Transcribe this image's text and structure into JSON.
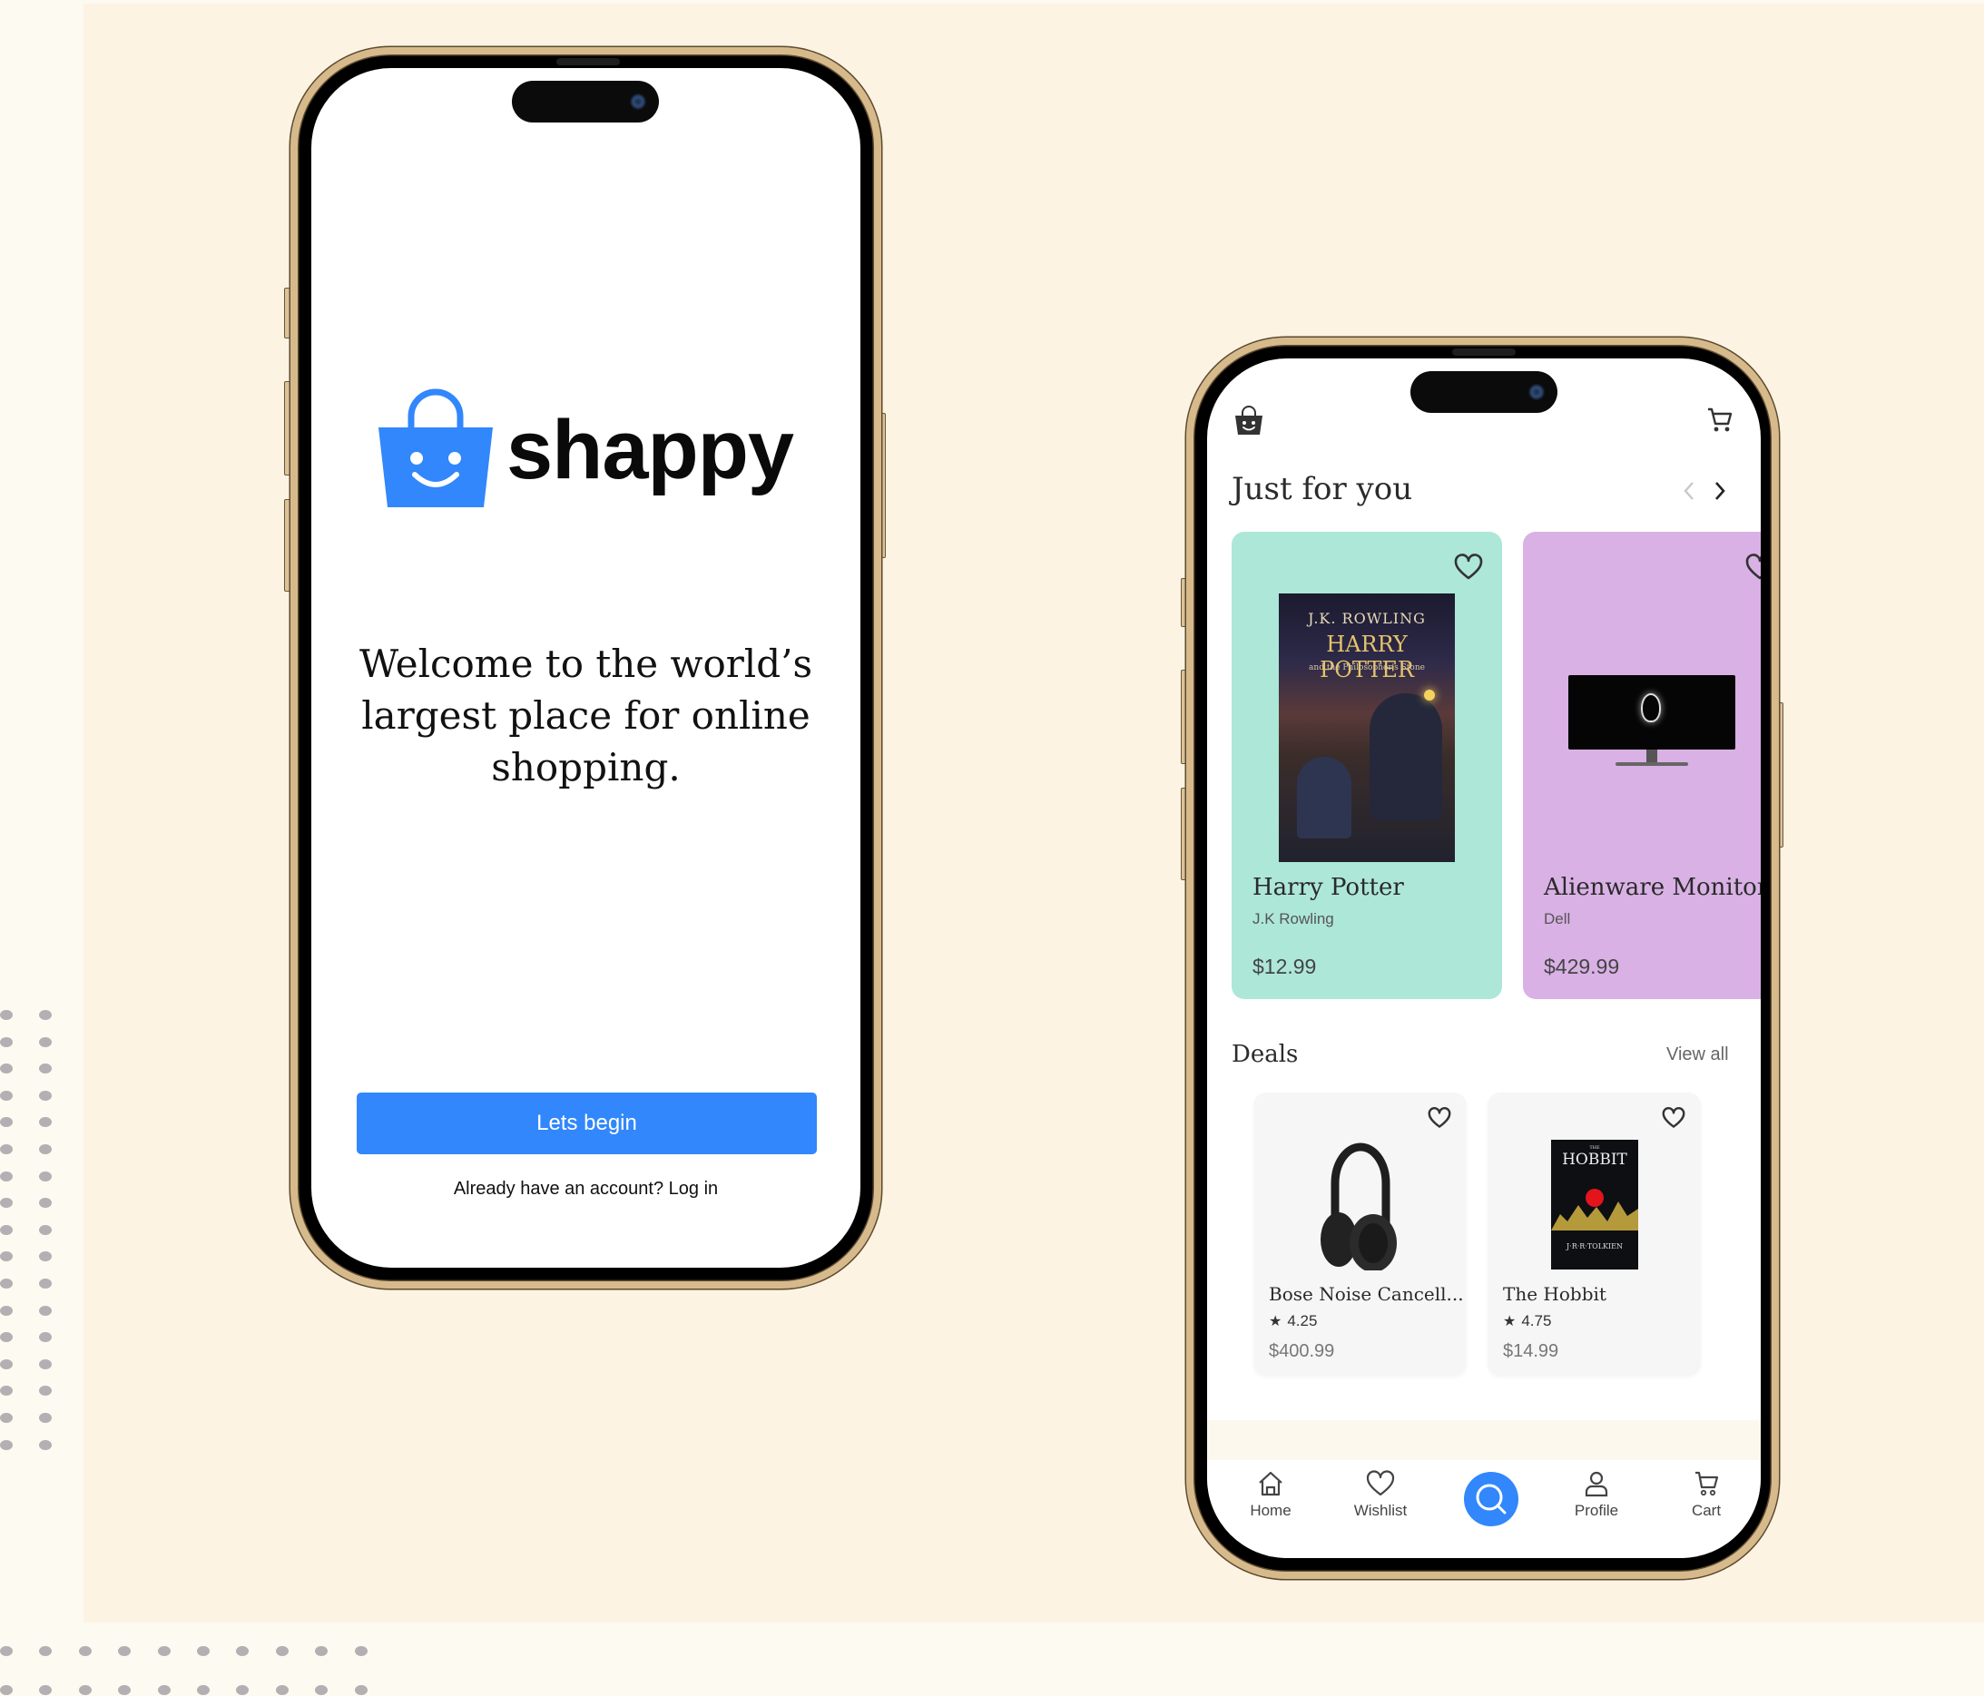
{
  "colors": {
    "brand_blue": "#3187fb",
    "panel_beige": "#fdf3e3",
    "card_mint": "#ade7d8",
    "card_lilac": "#d9b1e5",
    "deal_card": "#f6f6f6"
  },
  "welcome_screen": {
    "brand_name": "shappy",
    "logo_icon": "smiling-shopping-bag-icon",
    "headline_lines": [
      "Welcome to the world’s",
      "largest place for online",
      "shopping."
    ],
    "primary_button": "Lets begin",
    "login_prompt": "Already have an account? Log in"
  },
  "home_screen": {
    "header": {
      "logo_icon": "shopping-bag-icon",
      "cart_icon": "cart-icon"
    },
    "featured": {
      "title": "Just for you",
      "prev_icon": "chevron-left-icon",
      "next_icon": "chevron-right-icon",
      "items": [
        {
          "name": "Harry Potter",
          "subtitle": "J.K Rowling",
          "price": "$12.99",
          "image": "harry-potter-book-cover",
          "cover_author": "J.K. ROWLING",
          "cover_title": "HARRY POTTER",
          "cover_subtitle": "and the Philosopher's Stone"
        },
        {
          "name": "Alienware Monitor",
          "subtitle": "Dell",
          "price": "$429.99",
          "image": "alienware-monitor"
        }
      ]
    },
    "deals": {
      "title": "Deals",
      "view_all": "View all",
      "items": [
        {
          "name": "Bose Noise Cancell...",
          "rating": "4.25",
          "price": "$400.99",
          "image": "bose-headphones"
        },
        {
          "name": "The Hobbit",
          "rating": "4.75",
          "price": "$14.99",
          "image": "the-hobbit-book-cover",
          "cover_title": "HOBBIT",
          "cover_the": "THE",
          "cover_author": "J·R·R·TOLKIEN"
        }
      ]
    },
    "bottom_nav": [
      {
        "label": "Home",
        "icon": "home-icon"
      },
      {
        "label": "Wishlist",
        "icon": "heart-icon"
      },
      {
        "label": "",
        "icon": "search-icon"
      },
      {
        "label": "Profile",
        "icon": "user-icon"
      },
      {
        "label": "Cart",
        "icon": "cart-icon"
      }
    ]
  }
}
